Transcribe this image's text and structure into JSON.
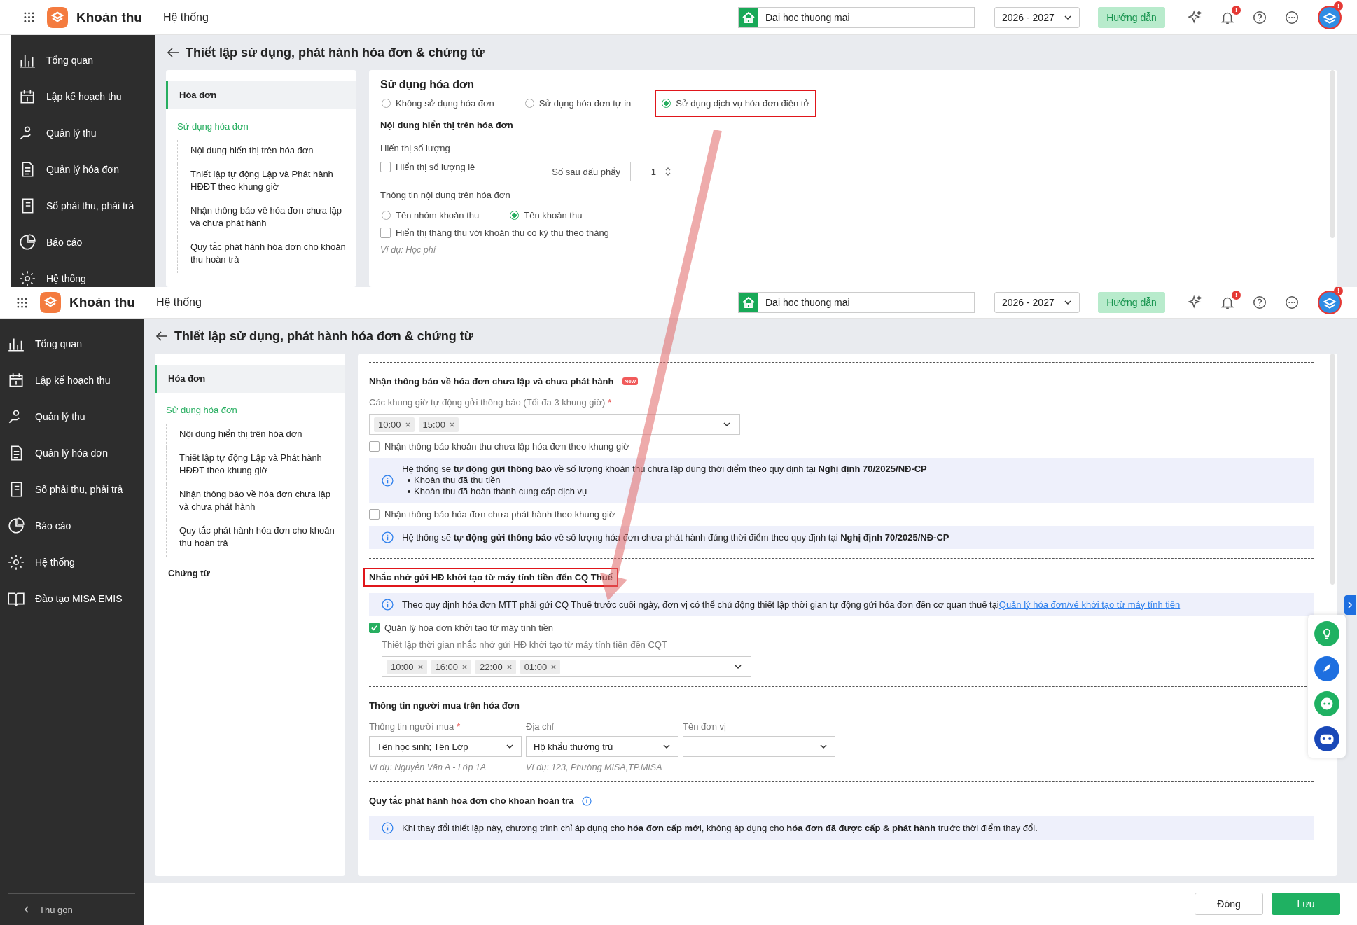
{
  "screens": [
    {
      "header": {
        "app_name": "Khoản thu",
        "menu": "Hệ thống",
        "school": "Dai hoc thuong mai",
        "year": "2026 - 2027",
        "guide_button": "Hướng dẫn",
        "notification_badge": "!",
        "avatar_badge": "!"
      },
      "sidebar": {
        "items": [
          {
            "label": "Tổng quan"
          },
          {
            "label": "Lập kế hoạch thu"
          },
          {
            "label": "Quản lý thu"
          },
          {
            "label": "Quản lý hóa đơn"
          },
          {
            "label": "Sổ phải thu, phải trả"
          },
          {
            "label": "Báo cáo"
          },
          {
            "label": "Hệ thống"
          }
        ]
      },
      "page_title": "Thiết lập sử dụng, phát hành hóa đơn & chứng từ",
      "nav": [
        {
          "label": "Hóa đơn",
          "selected": true,
          "children": [
            {
              "label": "Sử dụng hóa đơn",
              "selected": true
            },
            {
              "label": "Nội dung hiển thị trên hóa đơn",
              "selected": false
            },
            {
              "label": "Thiết lập tự động Lập và Phát hành HĐĐT theo khung giờ",
              "selected": false
            },
            {
              "label": "Nhận thông báo về hóa đơn chưa lập và chưa phát hành",
              "selected": false
            },
            {
              "label": "Quy tắc phát hành hóa đơn cho khoản thu hoàn trả",
              "selected": false
            }
          ]
        }
      ],
      "content": [
        {
          "kind": "title",
          "text": "Sử dụng hóa đơn"
        },
        {
          "kind": "radios",
          "options": [
            {
              "label": "Không sử dụng hóa đơn",
              "selected": false,
              "highlighted": false
            },
            {
              "label": "Sử dụng hóa đơn tự in",
              "selected": false,
              "highlighted": false
            },
            {
              "label": "Sử dụng dịch vụ hóa đơn điện tử",
              "selected": true,
              "highlighted": true
            }
          ]
        },
        {
          "kind": "subheading",
          "text": "Nội dung hiển thị trên hóa đơn"
        },
        {
          "kind": "label",
          "text": "Hiển thị số lượng"
        },
        {
          "kind": "spinner_row",
          "checkbox": {
            "label": "Hiển thị số lượng lẻ",
            "checked": false
          },
          "spinner_label": "Số sau dấu phẩy",
          "value": "1"
        },
        {
          "kind": "label",
          "text": "Thông tin nội dung trên hóa đơn"
        },
        {
          "kind": "radios",
          "options": [
            {
              "label": "Tên nhóm khoản thu",
              "selected": false,
              "highlighted": false
            },
            {
              "label": "Tên khoản thu",
              "selected": true,
              "highlighted": false
            }
          ]
        },
        {
          "kind": "checkbox",
          "label": "Hiển thị tháng thu với khoản thu có kỳ thu theo tháng",
          "checked": false
        },
        {
          "kind": "hint",
          "text": "Ví dụ: Học phí"
        }
      ]
    },
    {
      "header": {
        "app_name": "Khoản thu",
        "menu": "Hệ thống",
        "school": "Dai hoc thuong mai",
        "year": "2026 - 2027",
        "guide_button": "Hướng dẫn",
        "notification_badge": "!",
        "avatar_badge": "!"
      },
      "sidebar": {
        "items": [
          {
            "label": "Tổng quan"
          },
          {
            "label": "Lập kế hoạch thu"
          },
          {
            "label": "Quản lý thu"
          },
          {
            "label": "Quản lý hóa đơn"
          },
          {
            "label": "Sổ phải thu, phải trả"
          },
          {
            "label": "Báo cáo"
          },
          {
            "label": "Hệ thống"
          },
          {
            "label": "Đào tạo MISA EMIS"
          }
        ],
        "collapse": "Thu gọn"
      },
      "page_title": "Thiết lập sử dụng, phát hành hóa đơn & chứng từ",
      "nav": [
        {
          "label": "Hóa đơn",
          "selected": true,
          "children": [
            {
              "label": "Sử dụng hóa đơn",
              "selected": true
            },
            {
              "label": "Nội dung hiển thị trên hóa đơn",
              "selected": false
            },
            {
              "label": "Thiết lập tự động Lập và Phát hành HĐĐT theo khung giờ",
              "selected": false
            },
            {
              "label": "Nhận thông báo về hóa đơn chưa lập và chưa phát hành",
              "selected": false
            },
            {
              "label": "Quy tắc phát hành hóa đơn cho khoản thu hoàn trả",
              "selected": false
            }
          ]
        },
        {
          "label": "Chứng từ",
          "selected": false
        }
      ],
      "content": [
        {
          "kind": "divider"
        },
        {
          "kind": "subheading",
          "text": "Nhận thông báo về hóa đơn chưa lập và chưa phát hành",
          "badge": "New",
          "highlighted": false
        },
        {
          "kind": "tags",
          "label": "Các khung giờ tự động gửi thông báo (Tối đa 3 khung giờ)",
          "required_mark": "*",
          "tags": [
            "10:00",
            "15:00"
          ],
          "indented": false
        },
        {
          "kind": "checkbox",
          "label": "Nhận thông báo khoản thu chưa lập hóa đơn theo khung giờ",
          "checked": false
        },
        {
          "kind": "info",
          "text": "Hệ thống sẽ **tự động gửi thông báo** về số lượng khoản thu chưa lập đúng thời điểm theo quy định tại **Nghị định 70/2025/NĐ-CP**",
          "bullets": [
            "Khoản thu đã thu tiền",
            "Khoản thu đã hoàn thành cung cấp dịch vụ"
          ]
        },
        {
          "kind": "checkbox",
          "label": "Nhận thông báo hóa đơn chưa phát hành theo khung giờ",
          "checked": false
        },
        {
          "kind": "info",
          "text": "Hệ thống sẽ **tự động gửi thông báo** về số lượng hóa đơn chưa phát hành đúng thời điểm theo quy định tại **Nghị định 70/2025/NĐ-CP**"
        },
        {
          "kind": "divider"
        },
        {
          "kind": "subheading",
          "text": "Nhắc nhở gửi HĐ khởi tạo từ máy tính tiền đến CQ Thuế",
          "highlighted": true
        },
        {
          "kind": "info",
          "text": "Theo quy định hóa đơn MTT phải gửi CQ Thuế trước cuối ngày, đơn vị có thể chủ động thiết lập thời gian tự động gửi hóa đơn đến cơ quan thuế tại",
          "link": "Quản lý hóa đơn/vé khởi tạo từ máy tính tiền"
        },
        {
          "kind": "checkbox",
          "label": "Quản lý hóa đơn khởi tạo từ máy tính tiền",
          "checked": true
        },
        {
          "kind": "tags",
          "label": "Thiết lập thời gian nhắc nhở gửi HĐ khởi tạo từ máy tính tiền đến CQT",
          "tags": [
            "10:00",
            "16:00",
            "22:00",
            "01:00"
          ],
          "indented": true
        },
        {
          "kind": "divider"
        },
        {
          "kind": "subheading",
          "text": "Thông tin người mua trên hóa đơn",
          "highlighted": false
        },
        {
          "kind": "selects",
          "fields": [
            {
              "label": "Thông tin người mua",
              "required_mark": "*",
              "value": "Tên học sinh; Tên Lớp",
              "hint": "Ví dụ: Nguyễn Văn A - Lớp 1A"
            },
            {
              "label": "Địa chỉ",
              "value": "Hộ khẩu thường trú",
              "hint": "Ví dụ: 123, Phường MISA,TP.MISA"
            },
            {
              "label": "Tên đơn vị"
            }
          ]
        },
        {
          "kind": "divider"
        },
        {
          "kind": "subheading",
          "text": "Quy tắc phát hành hóa đơn cho khoản hoàn trả",
          "info_icon": true,
          "highlighted": false
        },
        {
          "kind": "info",
          "text": "Khi thay đổi thiết lập này, chương trình chỉ áp dụng cho **hóa đơn cấp mới**, không áp dụng cho **hóa đơn đã được cấp & phát hành** trước thời điểm thay đổi."
        }
      ],
      "footer_buttons": [
        {
          "label": "Đóng",
          "kind": "secondary"
        },
        {
          "label": "Lưu",
          "kind": "primary"
        }
      ],
      "side_widget": true
    }
  ]
}
